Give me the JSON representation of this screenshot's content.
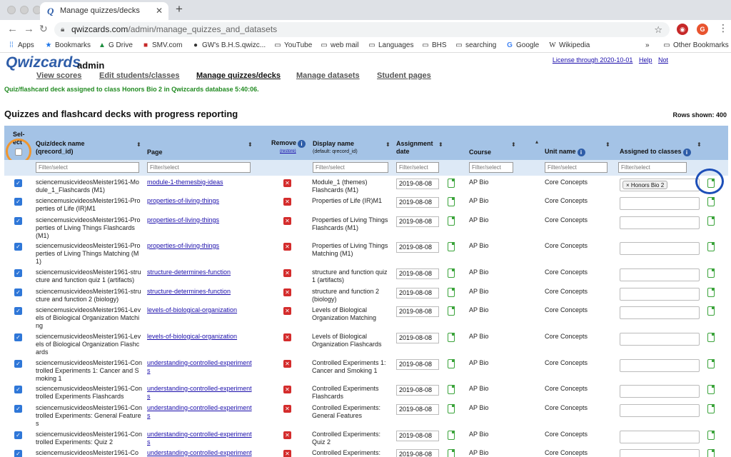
{
  "browser": {
    "tab_title": "Manage quizzes/decks",
    "tab_favicon": "Q",
    "url_host": "qwizcards.com",
    "url_path": "/admin/manage_quizzes_and_datasets",
    "profile_initial": "G",
    "bookmarks": [
      {
        "label": "Apps",
        "icon": "apps-icon"
      },
      {
        "label": "Bookmarks",
        "icon": "star-icon"
      },
      {
        "label": "G Drive",
        "icon": "drive-icon"
      },
      {
        "label": "SMV.com",
        "icon": "smv-icon"
      },
      {
        "label": "GW's B.H.S.qwizc...",
        "icon": "github-icon"
      },
      {
        "label": "YouTube",
        "icon": "folder-icon"
      },
      {
        "label": "web mail",
        "icon": "folder-icon"
      },
      {
        "label": "Languages",
        "icon": "folder-icon"
      },
      {
        "label": "BHS",
        "icon": "folder-icon"
      },
      {
        "label": "searching",
        "icon": "folder-icon"
      },
      {
        "label": "Google",
        "icon": "google-icon"
      },
      {
        "label": "Wikipedia",
        "icon": "wikipedia-icon"
      },
      {
        "label": "Other Bookmarks",
        "icon": "folder-icon"
      }
    ],
    "overflow": "»"
  },
  "header": {
    "logo": "Qwizcards",
    "role": "admin",
    "license_link": "License through 2020-10-01",
    "help_link": "Help",
    "not_link": "Not"
  },
  "nav": {
    "view_scores": "View scores",
    "edit_students": "Edit students/classes",
    "manage_quizzes": "Manage quizzes/decks",
    "manage_datasets": "Manage datasets",
    "student_pages": "Student pages"
  },
  "status_message": "Quiz/flashcard deck assigned to class Honors Bio 2 in Qwizcards database 5:40:06.",
  "section_title": "Quizzes and flashcard decks with progress reporting",
  "rows_shown": "Rows shown: 400",
  "columns": {
    "select_1": "Sel-",
    "select_2": "ect",
    "name_1": "Quiz/deck name",
    "name_2": "(qrecord_id)",
    "page": "Page",
    "remove": "Remove",
    "remove_sub": "(restore)",
    "display_1": "Display name",
    "display_2": "(default: qrecord_id)",
    "assign_1": "Assignment",
    "assign_2": "date",
    "course": "Course",
    "unit": "Unit name",
    "classes": "Assigned to classes"
  },
  "filter_placeholder": "Filter/select",
  "rows": [
    {
      "name": "sciencemusicvideosMeister1961-Module_1_Flashcards (M1)",
      "page": "module-1-themesbig-ideas",
      "display": "Module_1 (themes) Flashcards (M1)",
      "date": "2019-08-08",
      "course": "AP Bio",
      "unit": "Core Concepts",
      "classes": [
        "Honors Bio 2"
      ]
    },
    {
      "name": "sciencemusicvideosMeister1961-Properties of Life (IR)M1",
      "page": "properties-of-living-things",
      "display": "Properties of Life (IR)M1",
      "date": "2019-08-08",
      "course": "AP Bio",
      "unit": "Core Concepts",
      "classes": []
    },
    {
      "name": "sciencemusicvideosMeister1961-Properties of Living Things Flashcards (M1)",
      "page": "properties-of-living-things",
      "display": "Properties of Living Things Flashcards (M1)",
      "date": "2019-08-08",
      "course": "AP Bio",
      "unit": "Core Concepts",
      "classes": []
    },
    {
      "name": "sciencemusicvideosMeister1961-Properties of Living Things Matching (M1)",
      "page": "properties-of-living-things",
      "display": "Properties of Living Things Matching (M1)",
      "date": "2019-08-08",
      "course": "AP Bio",
      "unit": "Core Concepts",
      "classes": []
    },
    {
      "name": "sciencemusicvideosMeister1961-structure and function quiz 1 (artifacts)",
      "page": "structure-determines-function",
      "display": "structure and function quiz 1 (artifacts)",
      "date": "2019-08-08",
      "course": "AP Bio",
      "unit": "Core Concepts",
      "classes": []
    },
    {
      "name": "sciencemusicvideosMeister1961-structure and function 2 (biology)",
      "page": "structure-determines-function",
      "display": "structure and function 2 (biology)",
      "date": "2019-08-08",
      "course": "AP Bio",
      "unit": "Core Concepts",
      "classes": []
    },
    {
      "name": "sciencemusicvideosMeister1961-Levels of Biological Organization Matching",
      "page": "levels-of-biological-organization",
      "display": "Levels of Biological Organization Matching",
      "date": "2019-08-08",
      "course": "AP Bio",
      "unit": "Core Concepts",
      "classes": []
    },
    {
      "name": "sciencemusicvideosMeister1961-Levels of Biological Organization Flashcards",
      "page": "levels-of-biological-organization",
      "display": "Levels of Biological Organization Flashcards",
      "date": "2019-08-08",
      "course": "AP Bio",
      "unit": "Core Concepts",
      "classes": []
    },
    {
      "name": "sciencemusicvideosMeister1961-Controlled Experiments 1: Cancer and Smoking 1",
      "page": "understanding-controlled-experiments",
      "display": "Controlled Experiments 1: Cancer and Smoking 1",
      "date": "2019-08-08",
      "course": "AP Bio",
      "unit": "Core Concepts",
      "classes": []
    },
    {
      "name": "sciencemusicvideosMeister1961-Controlled Experiments Flashcards",
      "page": "understanding-controlled-experiments",
      "display": "Controlled Experiments Flashcards",
      "date": "2019-08-08",
      "course": "AP Bio",
      "unit": "Core Concepts",
      "classes": []
    },
    {
      "name": "sciencemusicvideosMeister1961-Controlled Experiments: General Features",
      "page": "understanding-controlled-experiments",
      "display": "Controlled Experiments: General Features",
      "date": "2019-08-08",
      "course": "AP Bio",
      "unit": "Core Concepts",
      "classes": []
    },
    {
      "name": "sciencemusicvideosMeister1961-Controlled Experiments: Quiz 2",
      "page": "understanding-controlled-experiments",
      "display": "Controlled Experiments: Quiz 2",
      "date": "2019-08-08",
      "course": "AP Bio",
      "unit": "Core Concepts",
      "classes": []
    },
    {
      "name": "sciencemusicvideosMeister1961-Co",
      "page": "understanding-controlled-experiment",
      "display": "Controlled Experiments:",
      "date": "2019-08-08",
      "course": "AP Bio",
      "unit": "Core Concepts",
      "classes": []
    }
  ],
  "colors": {
    "header_band": "#a4c3e6",
    "filter_band": "#dde9f6",
    "logo": "#2e5da8",
    "status_green": "#228b22",
    "checkbox_blue": "#2f77d8",
    "remove_red": "#d42c2c",
    "highlight_orange": "#f0962e",
    "highlight_blue": "#1d4fb8"
  }
}
